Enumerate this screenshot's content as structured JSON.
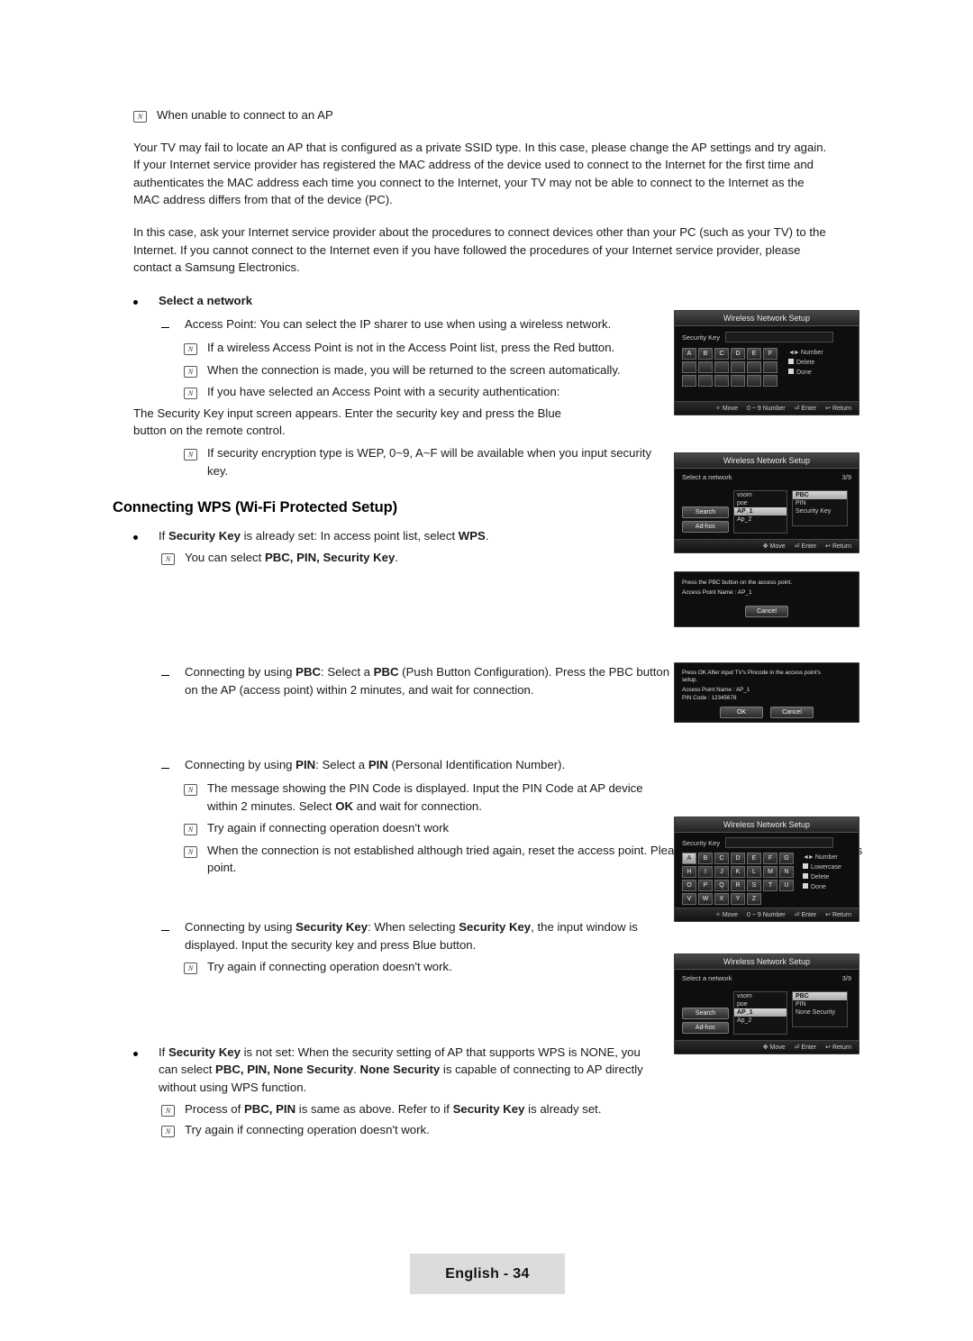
{
  "page": {
    "footer_label": "English - 34"
  },
  "body": {
    "note1": "When unable to connect to an AP",
    "para1": "Your TV may fail to locate an AP that is configured as a private SSID type. In this case, please change the AP settings and try again. If your Internet service provider has registered the MAC address of the device used to connect to the Internet for the first time and authenticates the MAC address each time you connect to the Internet, your TV may not be able to connect to the Internet as the MAC address differs from that of the device (PC).",
    "para2": "In this case, ask your Internet service provider about the procedures to connect devices other than your PC (such as your TV) to the Internet. If you cannot connect to the Internet even if you have followed the procedures of your Internet service provider, please contact a Samsung Electronics.",
    "select_network_heading": "Select a network",
    "dash1": "Access Point: You can select the IP sharer to use when using a wireless network.",
    "n1": "If a wireless Access Point is not in the Access Point list, press the Red button.",
    "n2": "When the connection is made, you will be returned to the screen automatically.",
    "n3": "If you have selected an Access Point with a security authentication:",
    "n3_sub": "The Security Key input screen appears. Enter the security key and press the Blue button on the remote control.",
    "n4": "If security encryption type is WEP, 0~9, A~F will be available when you input security key.",
    "heading_wps": "Connecting WPS (Wi-Fi Protected Setup)",
    "wps_b1_a": "If ",
    "wps_b1_b": "Security Key",
    "wps_b1_c": " is already set: In access point list, select ",
    "wps_b1_d": "WPS",
    "wps_b1_e": ".",
    "wps_b1_note_a": "You can select ",
    "wps_b1_note_b": "PBC, PIN, Security Key",
    "wps_b1_note_c": ".",
    "pbc_a": "Connecting by using ",
    "pbc_b": "PBC",
    "pbc_c": ": Select a ",
    "pbc_d": "PBC",
    "pbc_e": " (Push Button Configuration). Press the PBC button on the AP (access point) within 2 minutes, and wait for connection.",
    "pin_a": "Connecting by using ",
    "pin_b": "PIN",
    "pin_c": ": Select a ",
    "pin_d": "PIN",
    "pin_e": " (Personal Identification Number).",
    "pin_n1_a": "The message showing the PIN Code is displayed. Input the PIN Code at AP device within 2 minutes. Select ",
    "pin_n1_b": "OK",
    "pin_n1_c": " and wait for connection.",
    "pin_n2": "Try again if connecting operation doesn't work",
    "pin_n3": "When the connection is not established although tried again, reset the access point. Please refer to a manual of each access point.",
    "seckey_a": "Connecting by using ",
    "seckey_b": "Security Key",
    "seckey_c": ": When selecting ",
    "seckey_d": "Security Key",
    "seckey_e": ", the input window is displayed. Input the security key and press Blue button.",
    "seckey_note": "Try again if connecting operation doesn't work.",
    "notset_a": "If ",
    "notset_b": "Security Key",
    "notset_c": " is not set: When the security setting of AP that supports WPS is NONE, you can select ",
    "notset_d": "PBC, PIN, None Security",
    "notset_e": ". ",
    "notset_f": "None Security",
    "notset_g": " is capable of connecting to AP directly without using WPS function.",
    "notset_n1_a": "Process of ",
    "notset_n1_b": "PBC, PIN",
    "notset_n1_c": " is same as above. Refer to if ",
    "notset_n1_d": "Security Key",
    "notset_n1_e": " is already set.",
    "notset_n2": "Try again if connecting operation doesn't work."
  },
  "screens": {
    "security_key_1": {
      "title": "Wireless Network Setup",
      "label": "Security Key",
      "field_value": "",
      "keys": [
        "A",
        "B",
        "C",
        "D",
        "E",
        "F"
      ],
      "legend": [
        "Number",
        "Delete",
        "Done"
      ],
      "footer": [
        "Move",
        "0 ~ 9 Number",
        "Enter",
        "Return"
      ]
    },
    "select_network": {
      "title": "Wireless Network Setup",
      "label": "Select a network",
      "counter": "3/9",
      "buttons": [
        "Search",
        "Ad-hoc"
      ],
      "ap_list": [
        "vsom",
        "poe",
        "AP_1",
        "Ap_2"
      ],
      "options": [
        "PBC",
        "PIN",
        "Security Key"
      ],
      "footer": [
        "Move",
        "Enter",
        "Return"
      ]
    },
    "pbc_dialog": {
      "line1": "Press the PBC button on the access point.",
      "line2": "Access Point Name : AP_1",
      "button": "Cancel"
    },
    "pin_dialog": {
      "line1": "Press OK After input TV's Pincode in the access point's setup.",
      "line2": "Access Point Name : AP_1",
      "line3": "PIN Code : 12345678",
      "buttons": [
        "OK",
        "Cancel"
      ]
    },
    "security_key_2": {
      "title": "Wireless Network Setup",
      "label": "Security Key",
      "field_value": "",
      "keyrows": [
        [
          "A",
          "B",
          "C",
          "D",
          "E",
          "F",
          "G"
        ],
        [
          "H",
          "I",
          "J",
          "K",
          "L",
          "M",
          "N"
        ],
        [
          "O",
          "P",
          "Q",
          "R",
          "S",
          "T",
          "U"
        ],
        [
          "V",
          "W",
          "X",
          "Y",
          "Z",
          "",
          ""
        ]
      ],
      "legend": [
        "Number",
        "Lowercase",
        "Delete",
        "Done"
      ],
      "footer": [
        "Move",
        "0 ~ 9 Number",
        "Enter",
        "Return"
      ]
    },
    "none_security": {
      "title": "Wireless Network Setup",
      "label": "Select a network",
      "counter": "3/9",
      "buttons": [
        "Search",
        "Ad-hoc"
      ],
      "ap_list": [
        "vsom",
        "poe",
        "AP_1",
        "Ap_2"
      ],
      "options": [
        "PBC",
        "PIN",
        "None Security"
      ],
      "footer": [
        "Move",
        "Enter",
        "Return"
      ]
    }
  }
}
